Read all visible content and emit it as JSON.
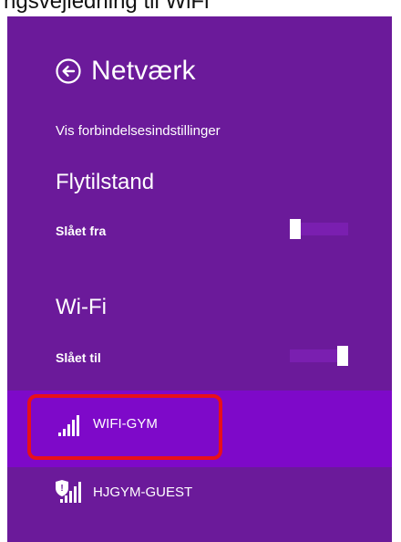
{
  "caption_fragment": "ngsvejledning til WiFi",
  "header": {
    "back_icon": "back-arrow-circle-icon",
    "title": "Netværk"
  },
  "connection_settings_link": "Vis forbindelsesindstillinger",
  "airplane_mode": {
    "title": "Flytilstand",
    "status": "Slået fra",
    "on": false
  },
  "wifi": {
    "title": "Wi-Fi",
    "status": "Slået til",
    "on": true
  },
  "networks": [
    {
      "name": "WIFI-GYM",
      "icon": "wifi-signal-icon",
      "secured": false,
      "selected": true
    },
    {
      "name": "HJGYM-GUEST",
      "icon": "wifi-signal-shield-icon",
      "secured": true,
      "selected": false
    }
  ],
  "colors": {
    "panel_background": "#6b1a9a",
    "selected_background": "#7e09c9",
    "toggle_track": "#7a1fb0",
    "highlight": "#e8101a",
    "text": "#ffffff"
  }
}
